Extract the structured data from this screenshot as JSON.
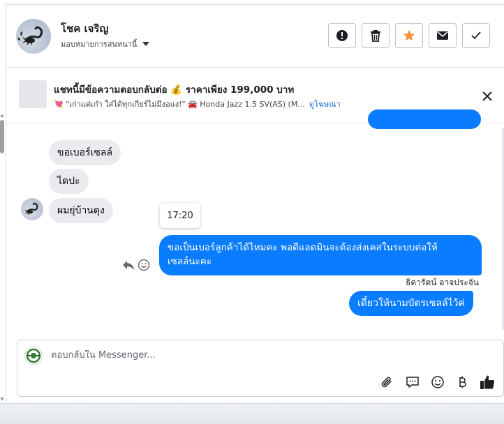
{
  "header": {
    "contact_name": "โชค เจริญ",
    "assign_label": "มอบหมายการสนทนานี้",
    "buttons": [
      "report",
      "delete",
      "star",
      "mark-unread",
      "done"
    ]
  },
  "ad": {
    "title": "แชทนี้มีข้อความตอบกลับต่อ 💰 ราคาเพียง 199,000 บาท",
    "subtitle": "💘 \"เก่าแต่เก๋า ใส่ได้ทุกเกียร์ไม่มีงอแง!\" 🚘 Honda Jazz 1.5 SV(AS) (M...",
    "link": "ดูโฆษณา"
  },
  "messages": {
    "in_1": "ขอเบอร์เซลล์",
    "in_2": "ไดปะ",
    "in_3": "ผมยุ่บ้านดุง",
    "time": "17:20",
    "out_1_line1": "ขอเป็นเบอร์ลูกค้าได้ไหมคะ พอดีแอดมินจะต้องส่งเคสในระบบต่อให้",
    "out_1_line2": "เซลล์นะคะ",
    "sender": "ธิดารัตน์ อาจประจัน",
    "out_2": "เดี๋ยวให้นามบัตรเซลล์ไว้ค่"
  },
  "composer": {
    "placeholder": "ตอบกลับใน Messenger...",
    "tools": [
      "attach-icon",
      "saved-reply-icon",
      "emoji-icon",
      "baht-icon",
      "like-icon"
    ]
  },
  "colors": {
    "outgoing": "#0a7cff",
    "incoming": "#e9ebef",
    "star": "#f7923b",
    "link": "#216fdb"
  }
}
